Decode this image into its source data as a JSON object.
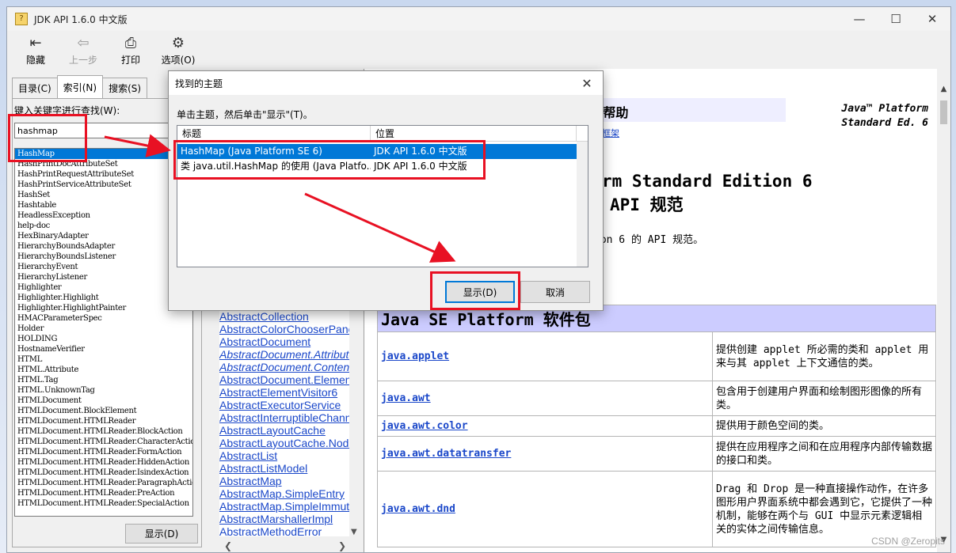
{
  "window": {
    "title": "JDK API 1.6.0 中文版",
    "app_icon": "?",
    "minimize": "—",
    "maximize": "☐",
    "close": "✕"
  },
  "toolbar": [
    {
      "label": "隐藏",
      "icon": "⇤",
      "icon_name": "hide-icon",
      "enabled": true
    },
    {
      "label": "上一步",
      "icon": "⇦",
      "icon_name": "back-icon",
      "enabled": false
    },
    {
      "label": "打印",
      "icon": "⎙",
      "icon_name": "print-icon",
      "enabled": true
    },
    {
      "label": "选项(O)",
      "icon": "⚙",
      "icon_name": "options-icon",
      "enabled": true
    }
  ],
  "nav": {
    "tabs": [
      {
        "label": "目录(C)"
      },
      {
        "label": "索引(N)"
      },
      {
        "label": "搜索(S)"
      }
    ],
    "keyword_label": "键入关键字进行查找(W):",
    "keyword_value": "hashmap",
    "index_items": [
      "HashMap",
      "HashPrintDocAttributeSet",
      "HashPrintRequestAttributeSet",
      "HashPrintServiceAttributeSet",
      "HashSet",
      "Hashtable",
      "HeadlessException",
      "help-doc",
      "HexBinaryAdapter",
      "HierarchyBoundsAdapter",
      "HierarchyBoundsListener",
      "HierarchyEvent",
      "HierarchyListener",
      "Highlighter",
      "Highlighter.Highlight",
      "Highlighter.HighlightPainter",
      "HMACParameterSpec",
      "Holder",
      "HOLDING",
      "HostnameVerifier",
      "HTML",
      "HTML.Attribute",
      "HTML.Tag",
      "HTML.UnknownTag",
      "HTMLDocument",
      "HTMLDocument.BlockElement",
      "HTMLDocument.HTMLReader",
      "HTMLDocument.HTMLReader.BlockAction",
      "HTMLDocument.HTMLReader.CharacterAction",
      "HTMLDocument.HTMLReader.FormAction",
      "HTMLDocument.HTMLReader.HiddenAction",
      "HTMLDocument.HTMLReader.IsindexAction",
      "HTMLDocument.HTMLReader.ParagraphAction",
      "HTMLDocument.HTMLReader.PreAction",
      "HTMLDocument.HTMLReader.SpecialAction"
    ],
    "show_button": "显示(D)"
  },
  "class_list": [
    {
      "name": "AbstractCollection",
      "italic": false
    },
    {
      "name": "AbstractColorChooserPanel",
      "italic": false
    },
    {
      "name": "AbstractDocument",
      "italic": false
    },
    {
      "name": "AbstractDocument.AttributeContext",
      "italic": true
    },
    {
      "name": "AbstractDocument.Content",
      "italic": true
    },
    {
      "name": "AbstractDocument.ElementEdit",
      "italic": false
    },
    {
      "name": "AbstractElementVisitor6",
      "italic": false
    },
    {
      "name": "AbstractExecutorService",
      "italic": false
    },
    {
      "name": "AbstractInterruptibleChannel",
      "italic": false
    },
    {
      "name": "AbstractLayoutCache",
      "italic": false
    },
    {
      "name": "AbstractLayoutCache.NodeDimensions",
      "italic": false
    },
    {
      "name": "AbstractList",
      "italic": false
    },
    {
      "name": "AbstractListModel",
      "italic": false
    },
    {
      "name": "AbstractMap",
      "italic": false
    },
    {
      "name": "AbstractMap.SimpleEntry",
      "italic": false
    },
    {
      "name": "AbstractMap.SimpleImmutableEntry",
      "italic": false
    },
    {
      "name": "AbstractMarshallerImpl",
      "italic": false
    },
    {
      "name": "AbstractMethodError",
      "italic": false
    }
  ],
  "content": {
    "help_link": "帮助",
    "help_prefix": "|",
    "frame_link": "框架",
    "platform_line1": "Java™ Platform",
    "platform_line2": "Standard Ed. 6",
    "heading1": "rm Standard Edition 6",
    "heading2": "API 规范",
    "intro": "ion 6 的 API 规范。",
    "table_header": "Java SE Platform 软件包",
    "packages": [
      {
        "name": "java.applet",
        "desc": "提供创建 applet 所必需的类和 applet 用来与其 applet 上下文通信的类。"
      },
      {
        "name": "java.awt",
        "desc": "包含用于创建用户界面和绘制图形图像的所有类。"
      },
      {
        "name": "java.awt.color",
        "desc": "提供用于颜色空间的类。"
      },
      {
        "name": "java.awt.datatransfer",
        "desc": "提供在应用程序之间和在应用程序内部传输数据的接口和类。"
      },
      {
        "name": "java.awt.dnd",
        "desc": "Drag 和 Drop 是一种直接操作动作，在许多图形用户界面系统中都会遇到它，它提供了一种机制，能够在两个与 GUI 中显示元素逻辑相关的实体之间传输信息。"
      }
    ]
  },
  "dialog": {
    "title": "找到的主题",
    "close": "✕",
    "instruction": "单击主题，然后单击\"显示\"(T)。",
    "columns": [
      "标题",
      "位置"
    ],
    "rows": [
      {
        "title": "HashMap (Java Platform SE 6)",
        "location": "JDK API 1.6.0 中文版"
      },
      {
        "title": "类 java.util.HashMap 的使用 (Java Platfo...",
        "location": "JDK API 1.6.0 中文版"
      }
    ],
    "show_button": "显示(D)",
    "cancel_button": "取消"
  },
  "watermark": "CSDN @Zeropits",
  "colors": {
    "selection": "#0078d7",
    "annotation": "#e81123",
    "table_header_bg": "#ccccff",
    "link": "#1a47c9"
  }
}
